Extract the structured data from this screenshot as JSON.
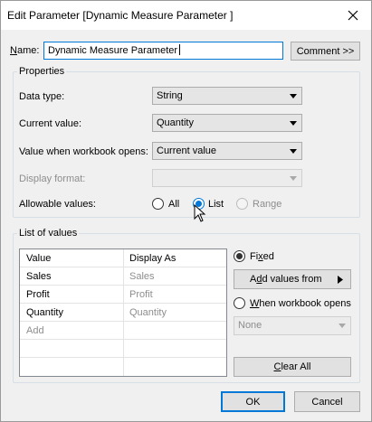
{
  "dialog": {
    "title": "Edit Parameter [Dynamic Measure Parameter ]",
    "close_icon": "close-icon"
  },
  "name_row": {
    "label": "Name:",
    "value": "Dynamic Measure Parameter",
    "comment_button": "Comment >>"
  },
  "properties": {
    "group_label": "Properties",
    "data_type_label": "Data type:",
    "data_type_value": "String",
    "current_value_label": "Current value:",
    "current_value_value": "Quantity",
    "workbook_opens_label": "Value when workbook opens:",
    "workbook_opens_value": "Current value",
    "display_format_label": "Display format:",
    "display_format_value": "",
    "allowable_label": "Allowable values:",
    "allowable_options": [
      "All",
      "List",
      "Range"
    ],
    "allowable_selected": "List"
  },
  "list_of_values": {
    "group_label": "List of values",
    "columns": [
      "Value",
      "Display As"
    ],
    "rows": [
      {
        "value": "Sales",
        "display": "Sales"
      },
      {
        "value": "Profit",
        "display": "Profit"
      },
      {
        "value": "Quantity",
        "display": "Quantity"
      }
    ],
    "add_placeholder": "Add",
    "fixed_label": "Fixed",
    "add_values_button": "Add values from",
    "when_workbook_opens_label": "When workbook opens",
    "none_dropdown": "None",
    "clear_all_button": "Clear All",
    "source_selected": "Fixed"
  },
  "footer": {
    "ok_button": "OK",
    "cancel_button": "Cancel"
  },
  "colors": {
    "accent": "#0078d7",
    "disabled_text": "#8d8d8d"
  }
}
